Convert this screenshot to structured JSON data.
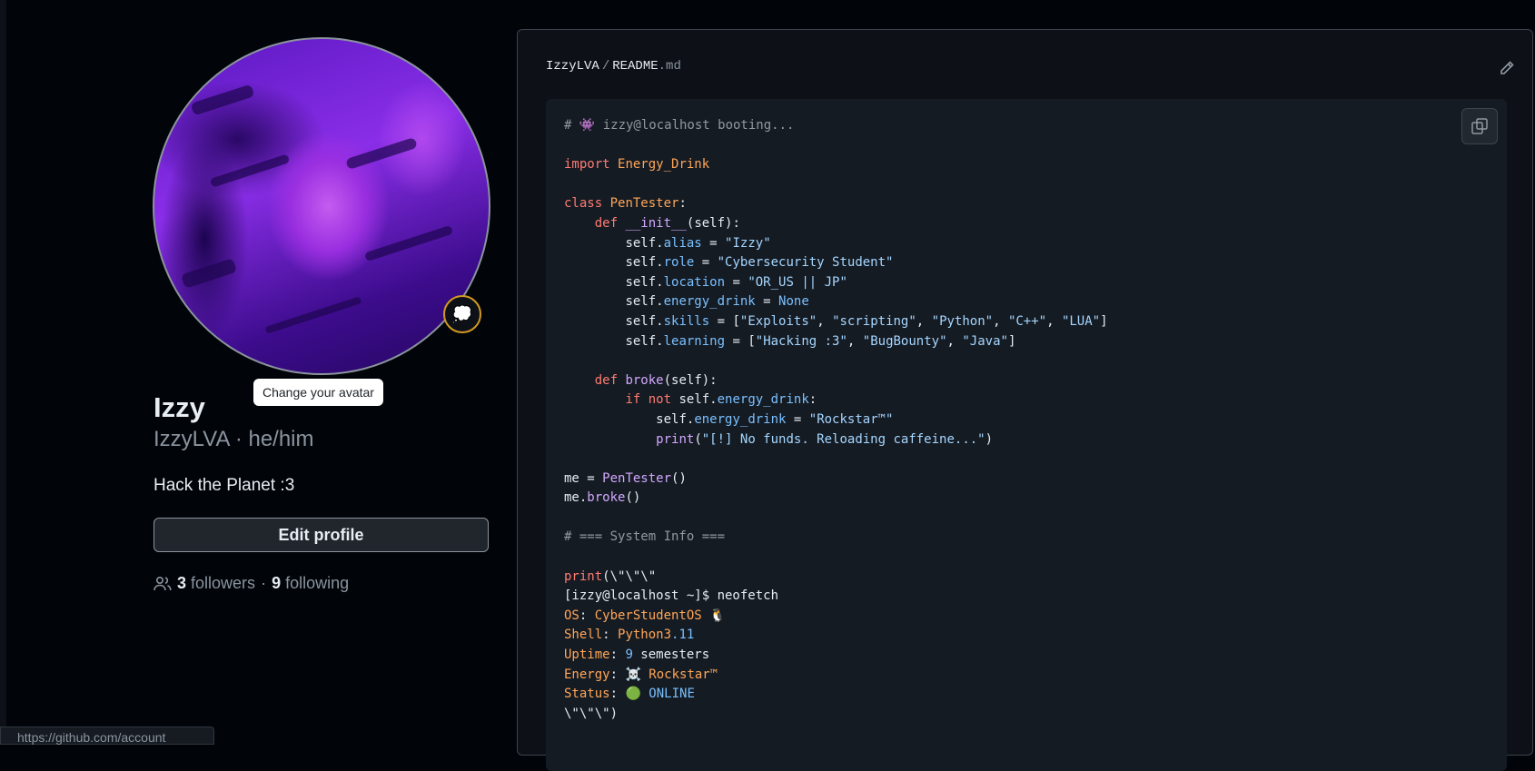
{
  "profile": {
    "display_name": "Izzy",
    "login_line": "IzzyLVA · he/him",
    "bio": "Hack the Planet :3",
    "edit_button": "Edit profile",
    "avatar_tooltip": "Change your avatar",
    "status_emoji": "💭",
    "followers_count": "3",
    "followers_label": "followers",
    "following_count": "9",
    "following_label": "following",
    "follow_separator": "·"
  },
  "status_bar": {
    "url": "https://github.com/account"
  },
  "readme": {
    "owner": "IzzyLVA",
    "separator": "/",
    "file_base": "README",
    "file_ext": ".md",
    "edit_icon": "pencil-icon",
    "copy_icon": "copy-icon",
    "code": {
      "l1_comment": "# 👾 izzy@localhost booting...",
      "l2_kw": "import",
      "l2_mod": "Energy_Drink",
      "l3_kw": "class",
      "l3_name": "PenTester",
      "l3_punct": ":",
      "l4_kw": "def",
      "l4_fn": "__init__",
      "l4_rest": "(self):",
      "self": "self.",
      "eq": " = ",
      "alias_attr": "alias",
      "alias_val": "\"Izzy\"",
      "role_attr": "role",
      "role_val": "\"Cybersecurity Student\"",
      "location_attr": "location",
      "location_val": "\"OR_US || JP\"",
      "energy_attr": "energy_drink",
      "energy_val": "None",
      "skills_attr": "skills",
      "skills_open": "[",
      "skills_items": [
        "\"Exploits\"",
        "\"scripting\"",
        "\"Python\"",
        "\"C++\"",
        "\"LUA\""
      ],
      "skills_close": "]",
      "learning_attr": "learning",
      "learning_items": [
        "\"Hacking :3\"",
        "\"BugBounty\"",
        "\"Java\""
      ],
      "comma": ", ",
      "broke_kw": "def",
      "broke_fn": "broke",
      "broke_rest": "(self):",
      "if_kw": "if",
      "not_kw": "not",
      "if_rest": " self.",
      "if_attr": "energy_drink",
      "if_end": ":",
      "set_attr": "energy_drink",
      "set_val": "\"Rockstar™\"",
      "print_fn": "print",
      "print_str": "\"[!] No funds. Reloading caffeine...\"",
      "me_var": "me",
      "me_cls": "PenTester",
      "me_call": "()",
      "me_dot": "me.",
      "me_method": "broke",
      "sys_comment": "# === System Info ===",
      "print2_fn": "print",
      "print2_rest": "(\\\"\\\"\\\"",
      "prompt": "[izzy@localhost ~]$ neofetch",
      "os_key": "OS",
      "os_val": "CyberStudentOS 🐧",
      "shell_key": "Shell",
      "shell_val_a": "Python3",
      "shell_val_b": ".11",
      "uptime_key": "Uptime",
      "uptime_num": "9",
      "uptime_unit": " semesters",
      "energy_key": "Energy",
      "energy_val2": "☠️ Rockstar™",
      "status_key": "Status",
      "status_val": "🟢 ONLINE",
      "end_line": "\\\"\\\"\\\")"
    }
  }
}
